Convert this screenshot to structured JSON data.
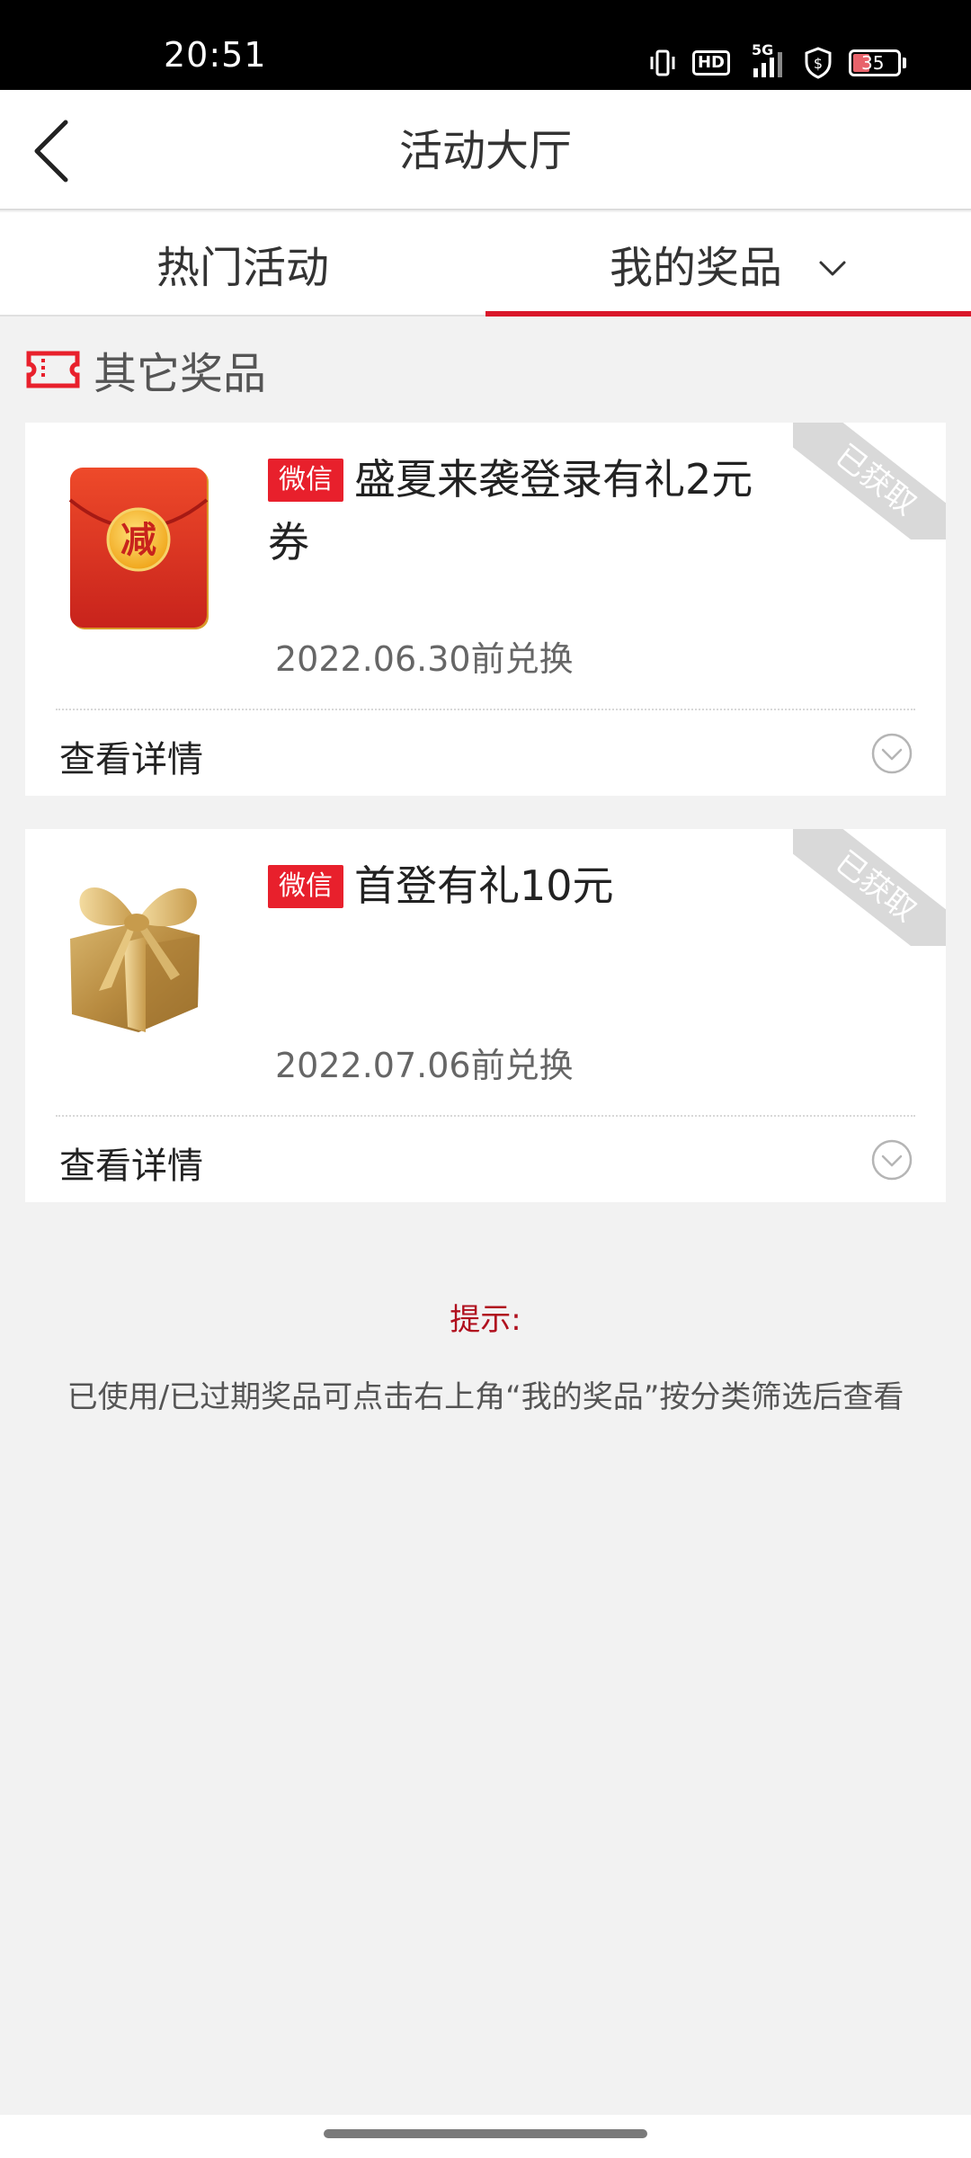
{
  "status_bar": {
    "time": "20:51",
    "network": "5G",
    "hd": "HD",
    "battery": "35"
  },
  "header": {
    "title": "活动大厅",
    "back_icon": "chevron-left-icon"
  },
  "tabs": [
    {
      "label": "热门活动",
      "active": false
    },
    {
      "label": "我的奖品",
      "active": true
    }
  ],
  "section": {
    "title": "其它奖品",
    "icon": "ticket-icon",
    "icon_color": "#e8202c"
  },
  "prizes": [
    {
      "badge": "微信",
      "title": "盛夏来袭登录有礼2元券",
      "date": "2022.06.30前兑换",
      "status": "已获取",
      "image": "red-envelope-icon",
      "envelope_char": "减",
      "detail_label": "查看详情"
    },
    {
      "badge": "微信",
      "title": "首登有礼10元",
      "date": "2022.07.06前兑换",
      "status": "已获取",
      "image": "gift-box-icon",
      "detail_label": "查看详情"
    }
  ],
  "tip": {
    "title": "提示:",
    "text": "已使用/已过期奖品可点击右上角“我的奖品”按分类筛选后查看"
  },
  "colors": {
    "accent": "#d9172a",
    "badge": "#e8202c",
    "background": "#f2f2f2"
  }
}
